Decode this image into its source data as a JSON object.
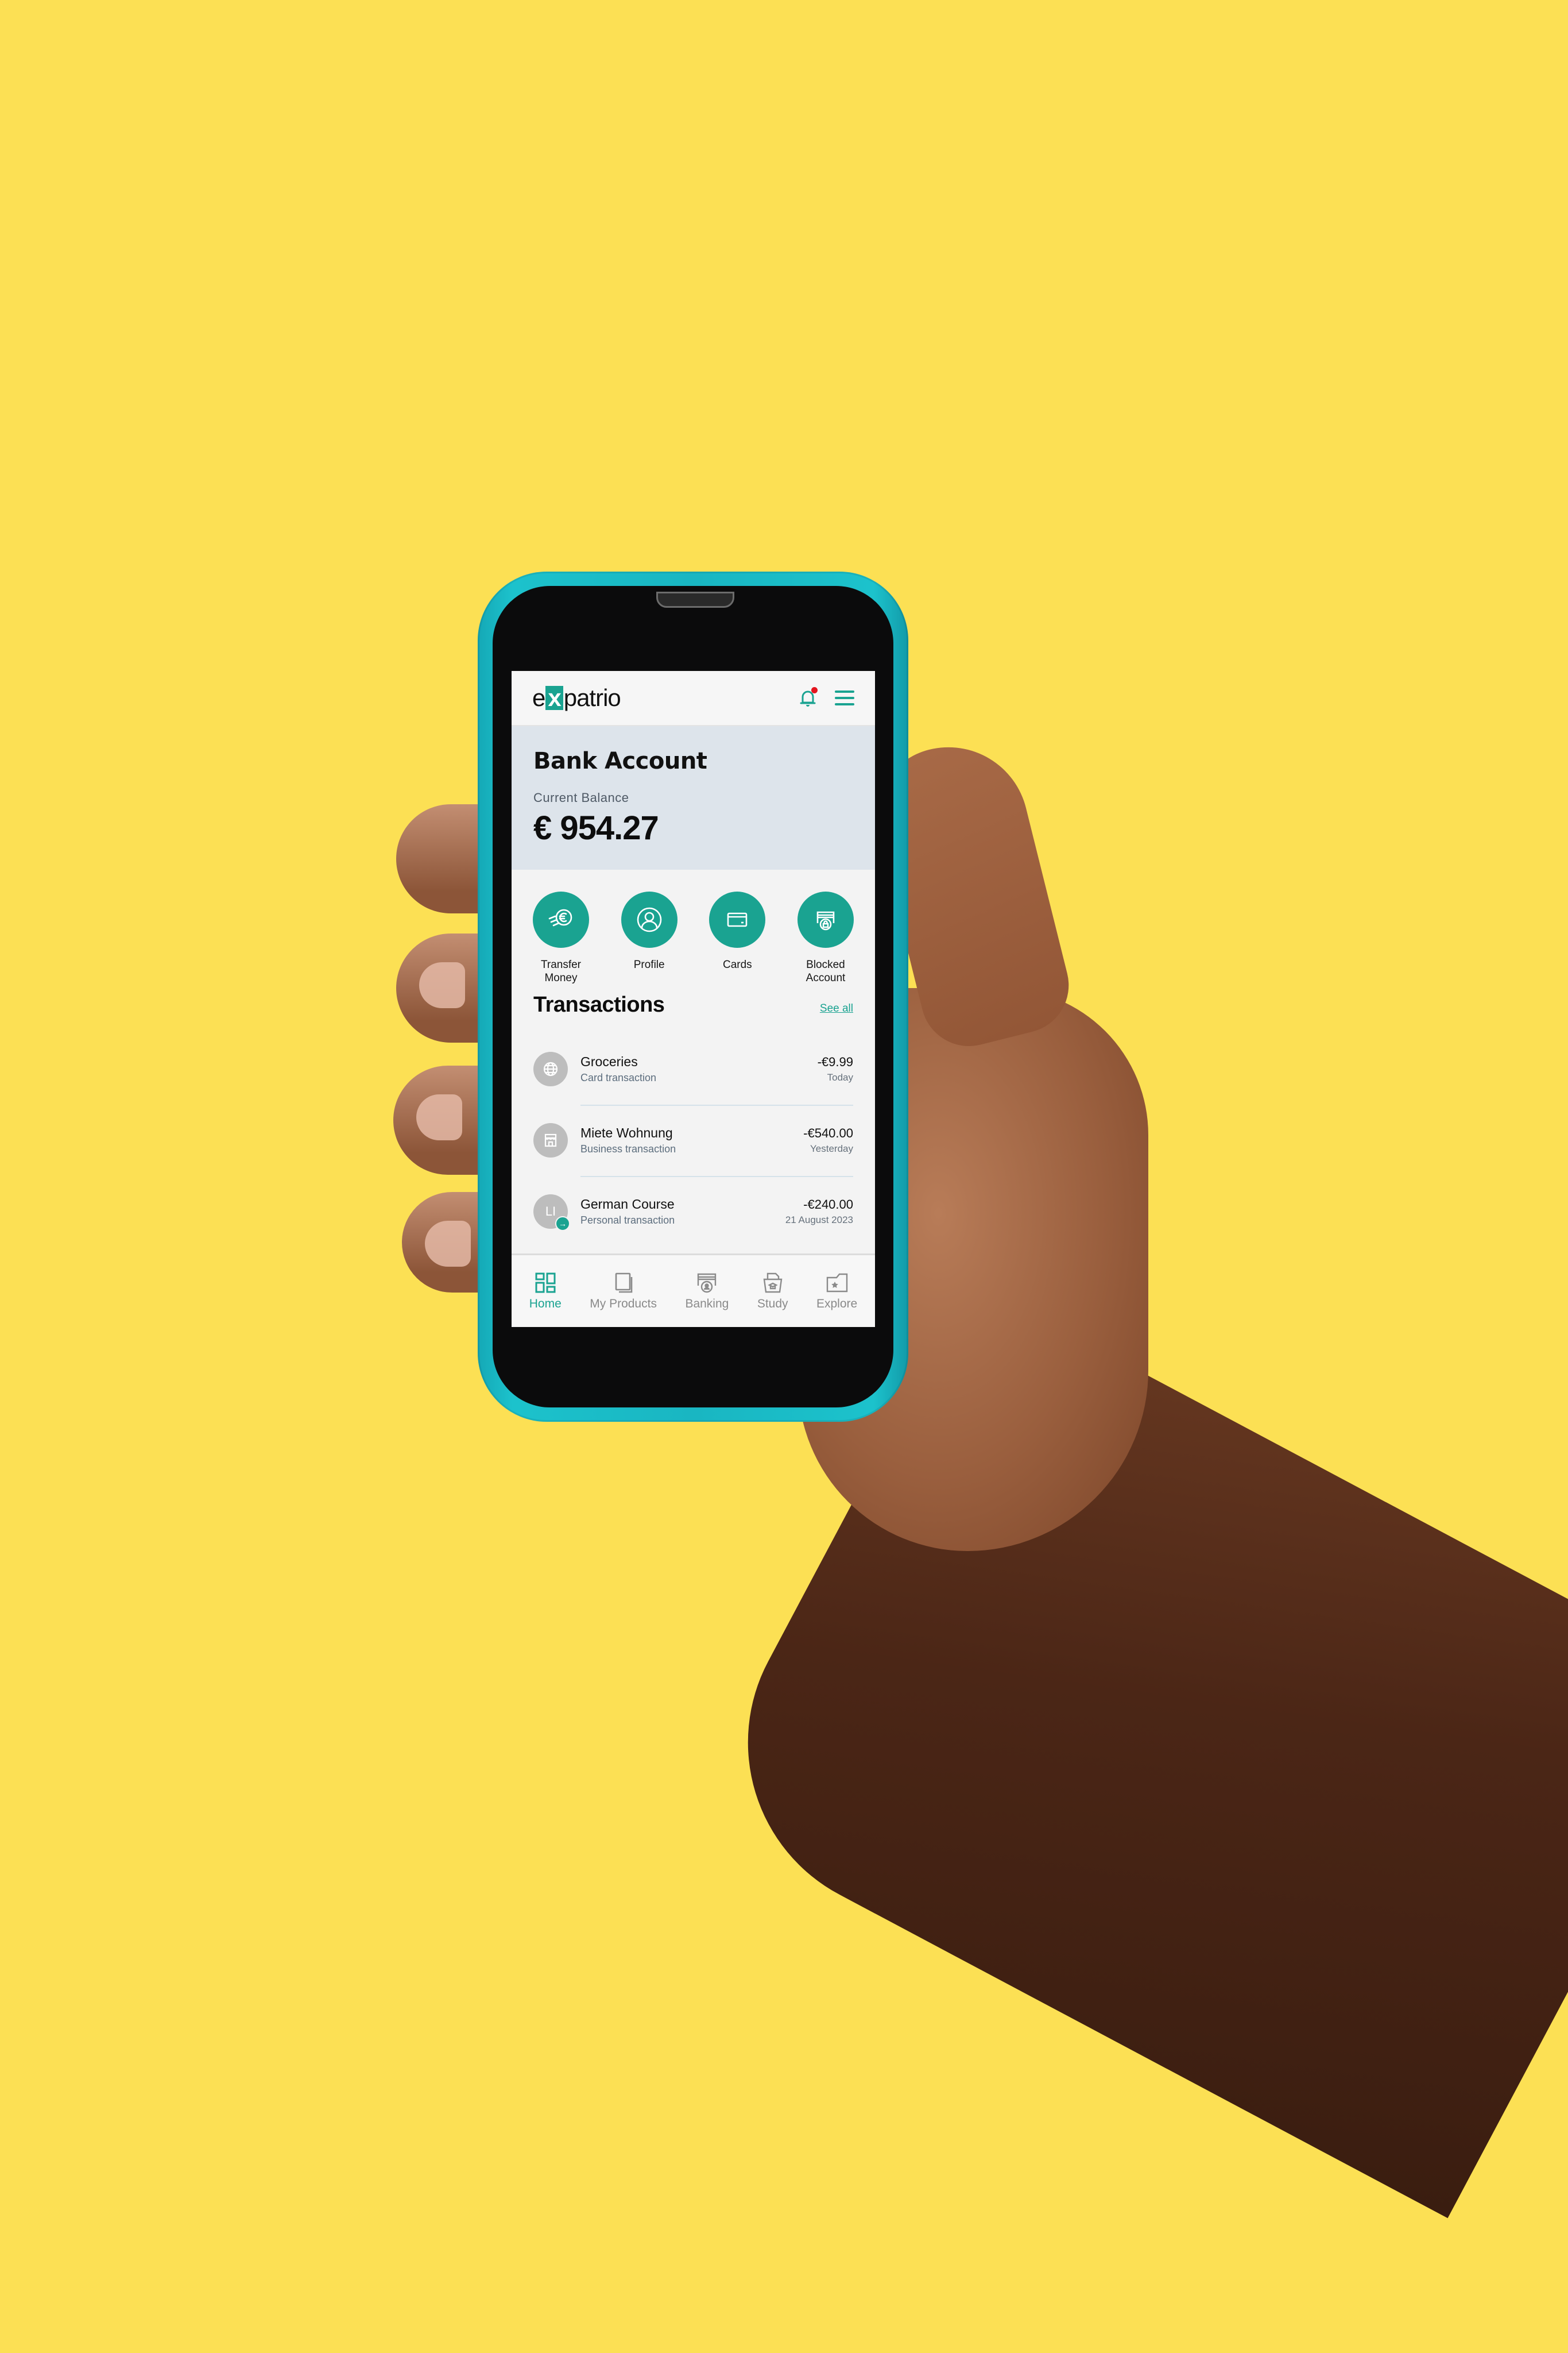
{
  "scene": {
    "background_color": "#FCE054",
    "phone_case_color": "#19B6C2"
  },
  "app": {
    "logo": {
      "prefix": "e",
      "highlight": "x",
      "suffix": "patrio"
    },
    "brand_color": "#1AA391",
    "notification_dot_color": "#E3141E",
    "header_icons": [
      "bell-icon",
      "menu-icon"
    ]
  },
  "balance_card": {
    "title": "Bank Account",
    "label": "Current Balance",
    "amount": "€ 954.27"
  },
  "actions": [
    {
      "label_line1": "Transfer",
      "label_line2": "Money",
      "icon": "transfer-euro-icon"
    },
    {
      "label_line1": "Profile",
      "label_line2": "",
      "icon": "profile-icon"
    },
    {
      "label_line1": "Cards",
      "label_line2": "",
      "icon": "card-icon"
    },
    {
      "label_line1": "Blocked",
      "label_line2": "Account",
      "icon": "blocked-account-icon"
    }
  ],
  "transactions": {
    "title": "Transactions",
    "see_all": "See all",
    "items": [
      {
        "name": "Groceries",
        "type": "Card transaction",
        "amount": "-€9.99",
        "date": "Today",
        "icon": "globe-icon"
      },
      {
        "name": "Miete Wohnung",
        "type": "Business transaction",
        "amount": "-€540.00",
        "date": "Yesterday",
        "icon": "store-icon"
      },
      {
        "name": "German Course",
        "type": "Personal transaction",
        "amount": "-€240.00",
        "date": "21 August 2023",
        "initials": "LI",
        "badge_icon": "arrow-right-icon"
      }
    ]
  },
  "bottom_nav": {
    "items": [
      {
        "label": "Home",
        "icon": "home-grid-icon",
        "active": true
      },
      {
        "label": "My Products",
        "icon": "products-icon",
        "active": false
      },
      {
        "label": "Banking",
        "icon": "banking-icon",
        "active": false
      },
      {
        "label": "Study",
        "icon": "study-icon",
        "active": false
      },
      {
        "label": "Explore",
        "icon": "explore-icon",
        "active": false
      }
    ]
  }
}
